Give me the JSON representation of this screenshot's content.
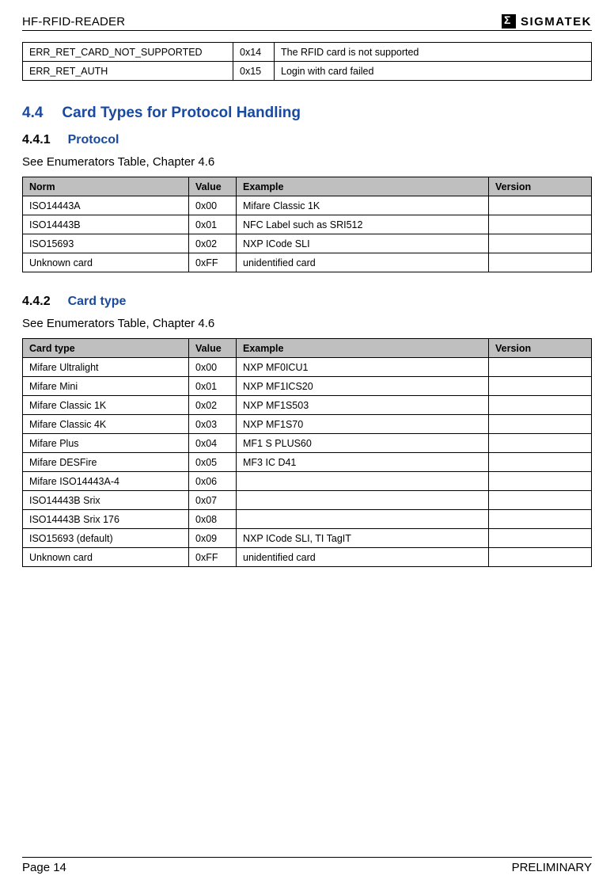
{
  "header": {
    "doc_title": "HF-RFID-READER",
    "logo_text": "SIGMATEK"
  },
  "top_table": {
    "rows": [
      {
        "name": "ERR_RET_CARD_NOT_SUPPORTED",
        "value": "0x14",
        "desc": "The RFID card is not supported"
      },
      {
        "name": "ERR_RET_AUTH",
        "value": "0x15",
        "desc": "Login with card failed"
      }
    ]
  },
  "section44": {
    "num": "4.4",
    "title": "Card Types for Protocol Handling"
  },
  "section441": {
    "num": "4.4.1",
    "title": "Protocol",
    "para": "See Enumerators Table, Chapter 4.6",
    "headers": {
      "c1": "Norm",
      "c2": "Value",
      "c3": "Example",
      "c4": "Version"
    },
    "rows": [
      {
        "c1": "ISO14443A",
        "c2": "0x00",
        "c3": "Mifare Classic 1K",
        "c4": ""
      },
      {
        "c1": "ISO14443B",
        "c2": "0x01",
        "c3": "NFC Label such as SRI512",
        "c4": ""
      },
      {
        "c1": "ISO15693",
        "c2": "0x02",
        "c3": "NXP ICode SLI",
        "c4": ""
      },
      {
        "c1": "Unknown card",
        "c2": "0xFF",
        "c3": "unidentified card",
        "c4": ""
      }
    ]
  },
  "section442": {
    "num": "4.4.2",
    "title": "Card type",
    "para": "See Enumerators Table, Chapter 4.6",
    "headers": {
      "c1": "Card type",
      "c2": "Value",
      "c3": "Example",
      "c4": "Version"
    },
    "rows": [
      {
        "c1": "Mifare Ultralight",
        "c2": "0x00",
        "c3": "NXP MF0ICU1",
        "c4": ""
      },
      {
        "c1": "Mifare Mini",
        "c2": "0x01",
        "c3": "NXP MF1ICS20",
        "c4": ""
      },
      {
        "c1": "Mifare Classic 1K",
        "c2": "0x02",
        "c3": "NXP MF1S503",
        "c4": ""
      },
      {
        "c1": "Mifare Classic 4K",
        "c2": "0x03",
        "c3": "NXP MF1S70",
        "c4": ""
      },
      {
        "c1": "Mifare Plus",
        "c2": "0x04",
        "c3": "MF1 S PLUS60",
        "c4": ""
      },
      {
        "c1": "Mifare DESFire",
        "c2": "0x05",
        "c3": "MF3 IC D41",
        "c4": ""
      },
      {
        "c1": "Mifare ISO14443A-4",
        "c2": "0x06",
        "c3": "",
        "c4": ""
      },
      {
        "c1": "ISO14443B Srix",
        "c2": "0x07",
        "c3": "",
        "c4": ""
      },
      {
        "c1": "ISO14443B Srix 176",
        "c2": "0x08",
        "c3": "",
        "c4": ""
      },
      {
        "c1": "ISO15693 (default)",
        "c2": "0x09",
        "c3": "NXP ICode SLI, TI TagIT",
        "c4": ""
      },
      {
        "c1": "Unknown card",
        "c2": "0xFF",
        "c3": "unidentified card",
        "c4": ""
      }
    ]
  },
  "footer": {
    "left": "Page 14",
    "right": "PRELIMINARY"
  }
}
